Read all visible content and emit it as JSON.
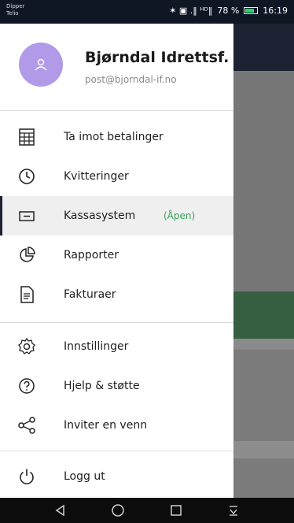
{
  "status": {
    "carrier_line1": "Dipper",
    "carrier_line2": "Telio",
    "signal_text": "✶ ▣ .‖ ᴴᴰ‖",
    "battery_percent": "78 %",
    "battery_level": 0.78,
    "time": "16:19"
  },
  "drawer": {
    "org_name": "Bjørndal Idrettsf...",
    "email": "post@bjorndal-if.no",
    "avatar_color": "#b19ae8"
  },
  "menu": {
    "payments": "Ta imot betalinger",
    "receipts": "Kvitteringer",
    "cash_system": "Kassasystem",
    "cash_system_status": "(Åpen)",
    "reports": "Rapporter",
    "invoices": "Fakturaer",
    "settings": "Innstillinger",
    "help": "Hjelp & støtte",
    "invite": "Inviter en venn",
    "logout": "Logg ut"
  },
  "icons": {
    "payments": "register-grid-icon",
    "receipts": "clock-icon",
    "cash_system": "card-reader-icon",
    "reports": "pie-chart-icon",
    "invoices": "document-icon",
    "settings": "gear-icon",
    "help": "question-circle-icon",
    "invite": "share-icon",
    "logout": "power-icon"
  },
  "colors": {
    "accent": "#1d2233",
    "active_badge": "#3aa35a"
  }
}
